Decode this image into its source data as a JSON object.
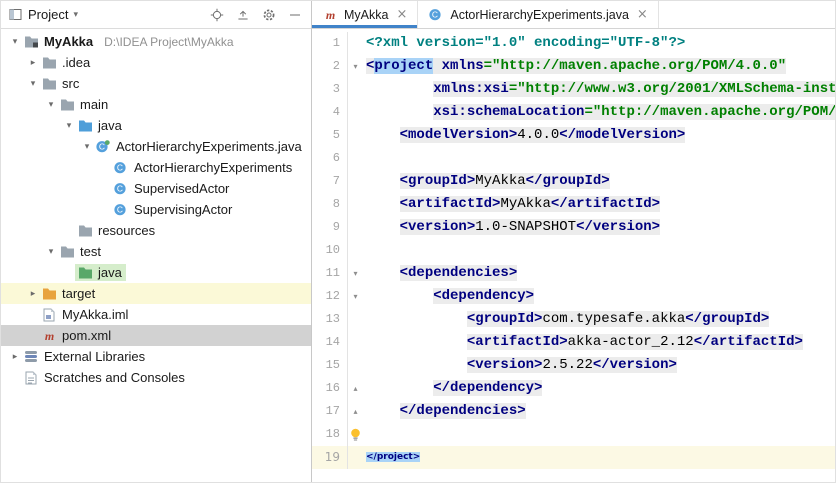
{
  "colors": {
    "accent_tab_underline": "#4083C9",
    "selection_inactive": "#D2D2D2",
    "caret_line": "#FCF9E4",
    "tag_match_highlight": "#A9D3F7",
    "token_run_background": "#ECECEC",
    "xml_tag": "#000080",
    "xml_attr_value": "#008000",
    "xml_prolog": "#008080",
    "row_added_green": "#D5EDCB",
    "row_excluded_yellow": "#FBF9D7",
    "maven_red": "#B3402F",
    "test_folder_green": "#59A869",
    "source_folder_blue": "#4E9ED9",
    "excluded_folder_orange": "#E8A33D"
  },
  "project_panel": {
    "header": {
      "title": "Project",
      "icons": [
        "locate",
        "collapse-all",
        "gear",
        "minimize"
      ]
    },
    "tree": [
      {
        "label": "MyAkka",
        "hint": "D:\\IDEA Project\\MyAkka",
        "level": 0,
        "chevron": "down",
        "icon": "project-folder",
        "bold": true
      },
      {
        "label": ".idea",
        "level": 1,
        "chevron": "right",
        "icon": "folder"
      },
      {
        "label": "src",
        "level": 1,
        "chevron": "down",
        "icon": "folder"
      },
      {
        "label": "main",
        "level": 2,
        "chevron": "down",
        "icon": "folder"
      },
      {
        "label": "java",
        "level": 3,
        "chevron": "down",
        "icon": "source-folder"
      },
      {
        "label": "ActorHierarchyExperiments.java",
        "level": 4,
        "chevron": "down",
        "icon": "class-run"
      },
      {
        "label": "ActorHierarchyExperiments",
        "level": 5,
        "icon": "class"
      },
      {
        "label": "SupervisedActor",
        "level": 5,
        "icon": "class"
      },
      {
        "label": "SupervisingActor",
        "level": 5,
        "icon": "class"
      },
      {
        "label": "resources",
        "level": 3,
        "icon": "folder"
      },
      {
        "label": "test",
        "level": 2,
        "chevron": "down",
        "icon": "folder"
      },
      {
        "label": "java",
        "level": 3,
        "icon": "test-folder",
        "rowbg": "green"
      },
      {
        "label": "target",
        "level": 1,
        "chevron": "right",
        "icon": "excluded-folder",
        "rowbg": "yellow"
      },
      {
        "label": "MyAkka.iml",
        "level": 1,
        "icon": "module-file"
      },
      {
        "label": "pom.xml",
        "level": 1,
        "icon": "maven",
        "selected": true
      },
      {
        "label": "External Libraries",
        "level": 0,
        "chevron": "right",
        "icon": "libraries"
      },
      {
        "label": "Scratches and Consoles",
        "level": 0,
        "icon": "scratches"
      }
    ]
  },
  "tabs": [
    {
      "label": "MyAkka",
      "icon": "maven",
      "active": true,
      "close": "×"
    },
    {
      "label": "ActorHierarchyExperiments.java",
      "icon": "class",
      "active": false,
      "close": "×"
    }
  ],
  "editor": {
    "lines": [
      {
        "n": 1,
        "indent": 0,
        "tokens": [
          {
            "s": "<?xml version=\"1.0\" encoding=\"UTF-8\"?>",
            "c": "pi"
          }
        ]
      },
      {
        "n": 2,
        "indent": 0,
        "run": true,
        "fold": "down",
        "tokens": [
          {
            "s": "<",
            "c": "tag"
          },
          {
            "s": "project",
            "c": "tag",
            "hl": true
          },
          {
            "s": " ",
            "c": "plain"
          },
          {
            "s": "xmlns",
            "c": "attr"
          },
          {
            "s": "=\"http://maven.apache.org/POM/4.0.0\"",
            "c": "val"
          }
        ]
      },
      {
        "n": 3,
        "indent": 8,
        "run": true,
        "tokens": [
          {
            "s": "xmlns:xsi",
            "c": "attr"
          },
          {
            "s": "=\"http://www.w3.org/2001/XMLSchema-inst",
            "c": "val"
          }
        ]
      },
      {
        "n": 4,
        "indent": 8,
        "run": true,
        "tokens": [
          {
            "s": "xsi:schemaLocation",
            "c": "attr"
          },
          {
            "s": "=\"http://maven.apache.org/POM/",
            "c": "val"
          }
        ]
      },
      {
        "n": 5,
        "indent": 4,
        "run": true,
        "tokens": [
          {
            "s": "<modelVersion>",
            "c": "tag"
          },
          {
            "s": "4.0.0",
            "c": "text"
          },
          {
            "s": "</modelVersion>",
            "c": "tag"
          }
        ]
      },
      {
        "n": 6,
        "indent": 0,
        "tokens": []
      },
      {
        "n": 7,
        "indent": 4,
        "run": true,
        "tokens": [
          {
            "s": "<groupId>",
            "c": "tag"
          },
          {
            "s": "MyAkka",
            "c": "text"
          },
          {
            "s": "</groupId>",
            "c": "tag"
          }
        ]
      },
      {
        "n": 8,
        "indent": 4,
        "run": true,
        "tokens": [
          {
            "s": "<artifactId>",
            "c": "tag"
          },
          {
            "s": "MyAkka",
            "c": "text"
          },
          {
            "s": "</artifactId>",
            "c": "tag"
          }
        ]
      },
      {
        "n": 9,
        "indent": 4,
        "run": true,
        "tokens": [
          {
            "s": "<version>",
            "c": "tag"
          },
          {
            "s": "1.0-SNAPSHOT",
            "c": "text"
          },
          {
            "s": "</version>",
            "c": "tag"
          }
        ]
      },
      {
        "n": 10,
        "indent": 0,
        "tokens": []
      },
      {
        "n": 11,
        "indent": 4,
        "run": true,
        "fold": "down",
        "tokens": [
          {
            "s": "<dependencies>",
            "c": "tag"
          }
        ]
      },
      {
        "n": 12,
        "indent": 8,
        "run": true,
        "fold": "down",
        "tokens": [
          {
            "s": "<dependency>",
            "c": "tag"
          }
        ]
      },
      {
        "n": 13,
        "indent": 12,
        "run": true,
        "tokens": [
          {
            "s": "<groupId>",
            "c": "tag"
          },
          {
            "s": "com.typesafe.akka",
            "c": "text"
          },
          {
            "s": "</groupId>",
            "c": "tag"
          }
        ]
      },
      {
        "n": 14,
        "indent": 12,
        "run": true,
        "tokens": [
          {
            "s": "<artifactId>",
            "c": "tag"
          },
          {
            "s": "akka-actor_2.12",
            "c": "text"
          },
          {
            "s": "</artifactId>",
            "c": "tag"
          }
        ]
      },
      {
        "n": 15,
        "indent": 12,
        "run": true,
        "tokens": [
          {
            "s": "<version>",
            "c": "tag"
          },
          {
            "s": "2.5.22",
            "c": "text"
          },
          {
            "s": "</version>",
            "c": "tag"
          }
        ]
      },
      {
        "n": 16,
        "indent": 8,
        "run": true,
        "fold": "up",
        "tokens": [
          {
            "s": "</dependency>",
            "c": "tag"
          }
        ]
      },
      {
        "n": 17,
        "indent": 4,
        "run": true,
        "fold": "up",
        "tokens": [
          {
            "s": "</dependencies>",
            "c": "tag"
          }
        ]
      },
      {
        "n": 18,
        "indent": 0,
        "bulb": true,
        "tokens": []
      },
      {
        "n": 19,
        "indent": 0,
        "caret": true,
        "tokens": [
          {
            "s": "</project>",
            "c": "tag",
            "hl": true
          }
        ]
      }
    ]
  }
}
